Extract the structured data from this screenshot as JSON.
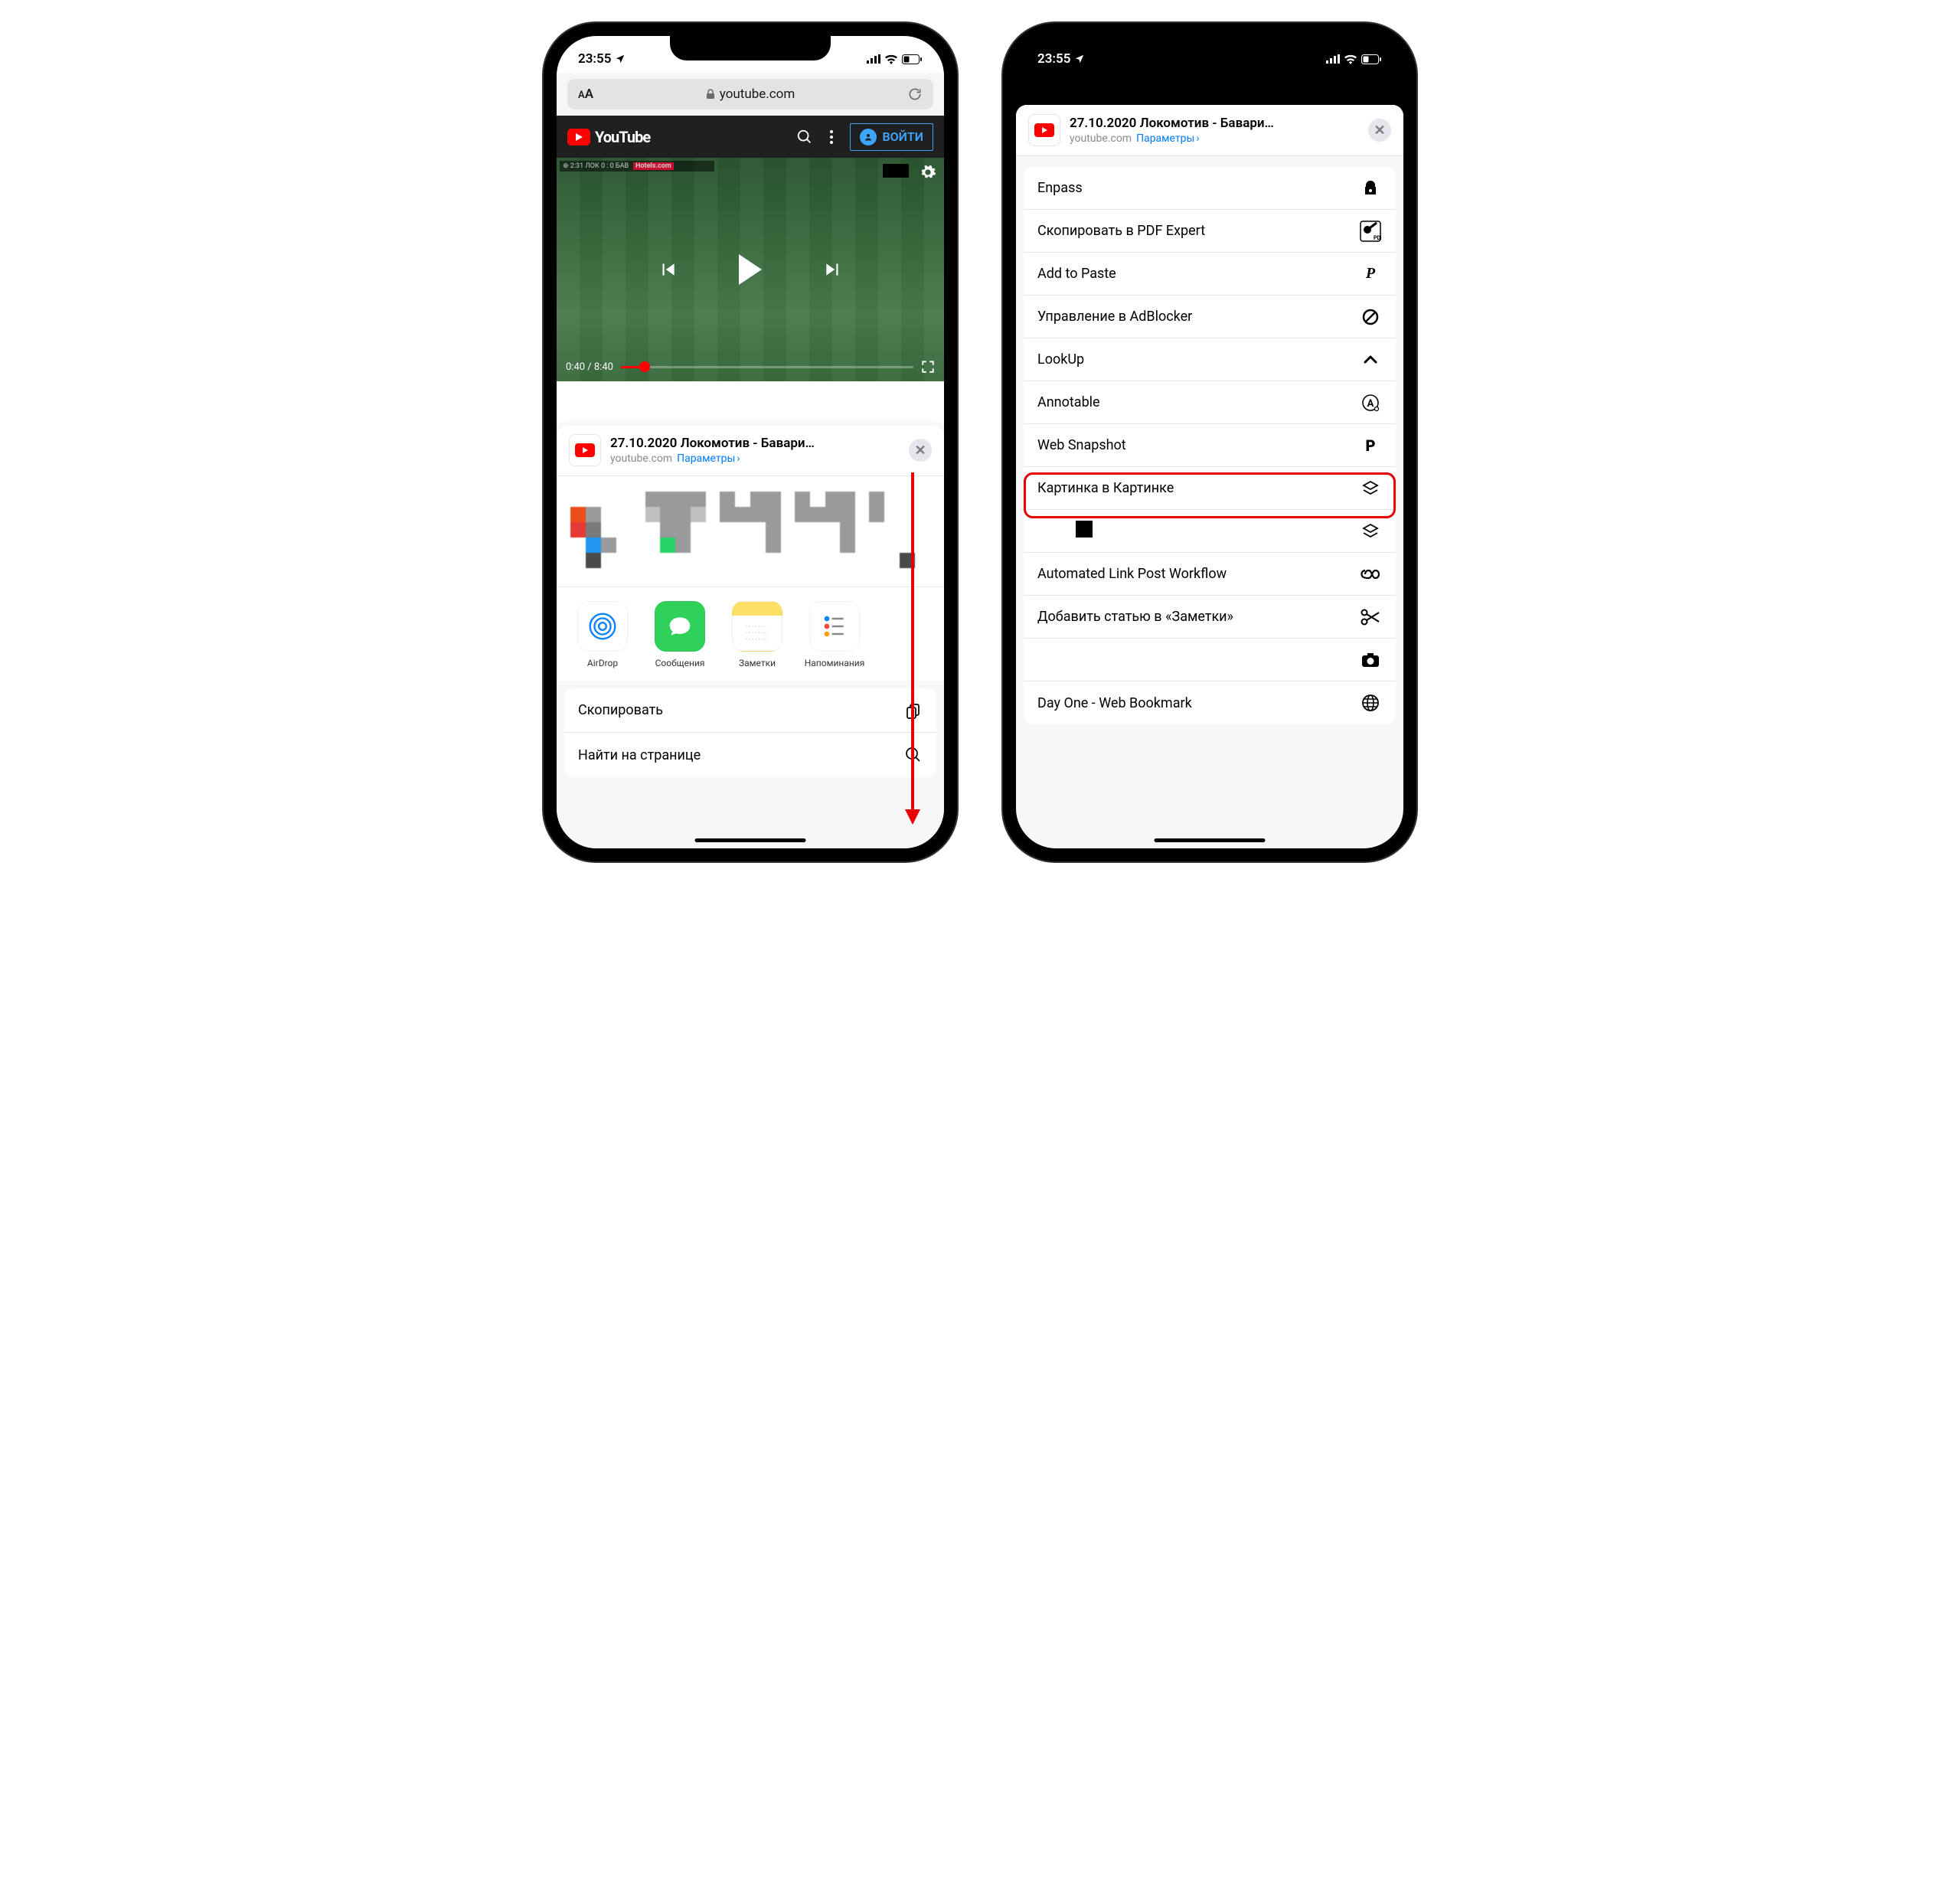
{
  "status": {
    "time": "23:55",
    "location_icon": "location"
  },
  "safari": {
    "url_display": "youtube.com",
    "text_size_label": "AA"
  },
  "youtube": {
    "brand": "YouTube",
    "signin_label": "ВОЙТИ",
    "video_time_elapsed": "0:40",
    "video_time_total": "8:40",
    "ad_banner": "Hotels.com",
    "score_bar": "⊕ 2:31  ЛОК 0 : 0 БАВ"
  },
  "share": {
    "title": "27.10.2020 Локомотив - Бавари…",
    "domain": "youtube.com",
    "params_label": "Параметры",
    "apps": [
      {
        "label": "AirDrop",
        "key": "airdrop"
      },
      {
        "label": "Сообщения",
        "key": "messages"
      },
      {
        "label": "Заметки",
        "key": "notes"
      },
      {
        "label": "Напоминания",
        "key": "reminders"
      }
    ],
    "actions": [
      {
        "label": "Скопировать",
        "icon": "copy"
      },
      {
        "label": "Найти на странице",
        "icon": "search"
      }
    ],
    "shortcuts": [
      {
        "label": "Enpass",
        "icon": "enpass"
      },
      {
        "label": "Скопировать в PDF Expert",
        "icon": "pdf-expert"
      },
      {
        "label": "Add to Paste",
        "icon": "paste-p"
      },
      {
        "label": "Управление в AdBlocker",
        "icon": "block"
      },
      {
        "label": "LookUp",
        "icon": "chevron-up"
      },
      {
        "label": "Annotable",
        "icon": "circle-a"
      },
      {
        "label": "Web Snapshot",
        "icon": "bold-p"
      },
      {
        "label": "Картинка в Картинке",
        "icon": "layers",
        "highlight": true
      },
      {
        "label": "",
        "icon": "layers"
      },
      {
        "label": "Automated Link Post Workflow",
        "icon": "infinity"
      },
      {
        "label": "Добавить статью в «Заметки»",
        "icon": "scissors"
      },
      {
        "label": "",
        "icon": "camera"
      },
      {
        "label": "Day One - Web Bookmark",
        "icon": "globe"
      }
    ]
  }
}
